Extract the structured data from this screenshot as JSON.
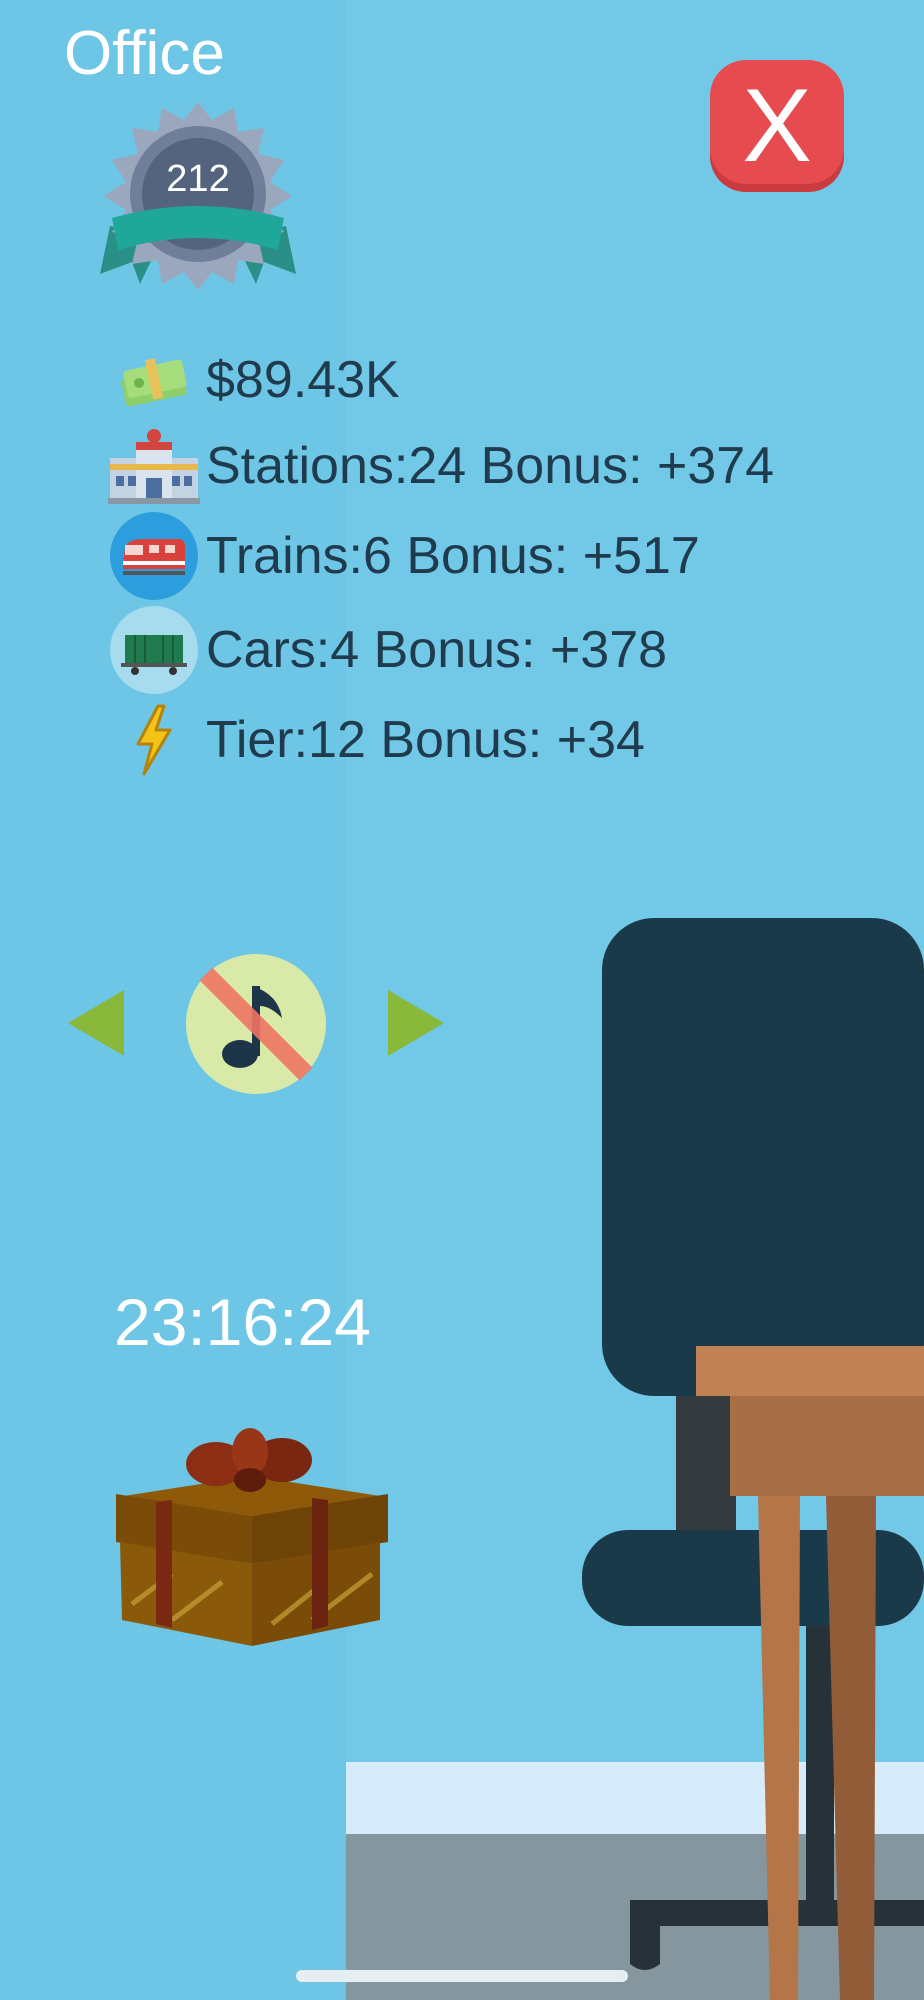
{
  "header": {
    "title": "Office"
  },
  "badge": {
    "level": "212"
  },
  "close_button": {
    "label": "X"
  },
  "stats": {
    "money": "$89.43K",
    "stations": "Stations:24 Bonus: +374",
    "trains": "Trains:6 Bonus: +517",
    "cars": "Cars:4 Bonus: +378",
    "tier": "Tier:12 Bonus: +34"
  },
  "icons": {
    "money": "money-icon",
    "stations": "station-icon",
    "trains": "train-icon",
    "cars": "freight-car-icon",
    "tier": "lightning-icon",
    "music": "music-muted-icon",
    "gift": "gift-icon"
  },
  "timer": {
    "value": "23:16:24"
  },
  "colors": {
    "background": "#6ec6e6",
    "text_dark": "#1f3b4d",
    "close": "#e64c4f",
    "arrow": "#8ab83a",
    "chair": "#1b3a49",
    "desk": "#b97b4f"
  }
}
